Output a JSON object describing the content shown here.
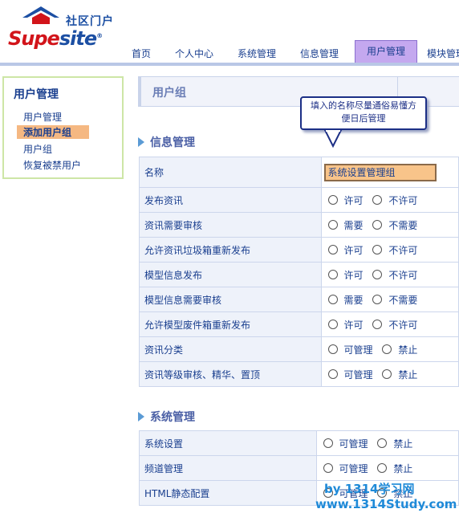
{
  "logo": {
    "cn": "社区门户",
    "part1": "Supe",
    "part2": "site",
    "mark": "®"
  },
  "nav": {
    "items": [
      "首页",
      "个人中心",
      "系统管理",
      "信息管理",
      "用户管理",
      "模块管理"
    ],
    "active_index": 4
  },
  "sidebar": {
    "title": "用户管理",
    "items": [
      "用户管理",
      "添加用户组",
      "用户组",
      "恢复被禁用户"
    ],
    "active_index": 1
  },
  "page_title": "用户组",
  "tooltip": {
    "line1": "填入的名称尽量通俗易懂方",
    "line2": "便日后管理"
  },
  "section_info": {
    "title": "信息管理",
    "name_row": {
      "label": "名称",
      "value": "系统设置管理组"
    },
    "rows": [
      {
        "label": "发布资讯",
        "options": [
          "许可",
          "不许可"
        ]
      },
      {
        "label": "资讯需要审核",
        "options": [
          "需要",
          "不需要"
        ]
      },
      {
        "label": "允许资讯垃圾箱重新发布",
        "options": [
          "许可",
          "不许可"
        ]
      },
      {
        "label": "模型信息发布",
        "options": [
          "许可",
          "不许可"
        ]
      },
      {
        "label": "模型信息需要审核",
        "options": [
          "需要",
          "不需要"
        ]
      },
      {
        "label": "允许模型废件箱重新发布",
        "options": [
          "许可",
          "不许可"
        ]
      },
      {
        "label": "资讯分类",
        "options": [
          "可管理",
          "禁止"
        ]
      },
      {
        "label": "资讯等级审核、精华、置顶",
        "options": [
          "可管理",
          "禁止"
        ]
      }
    ]
  },
  "section_sys": {
    "title": "系统管理",
    "rows": [
      {
        "label": "系统设置",
        "options": [
          "可管理",
          "禁止"
        ]
      },
      {
        "label": "频道管理",
        "options": [
          "可管理",
          "禁止"
        ]
      },
      {
        "label": "HTML静态配置",
        "options": [
          "可管理",
          "禁止"
        ]
      }
    ]
  },
  "watermark": {
    "line1": "by  1314学习网",
    "line2": "www.1314Study.com"
  },
  "colors": {
    "nav_active": "#c4a8ef",
    "sidebar_active": "#f5b882",
    "input_bg": "#f8c48a",
    "link": "#1a3f8f"
  }
}
